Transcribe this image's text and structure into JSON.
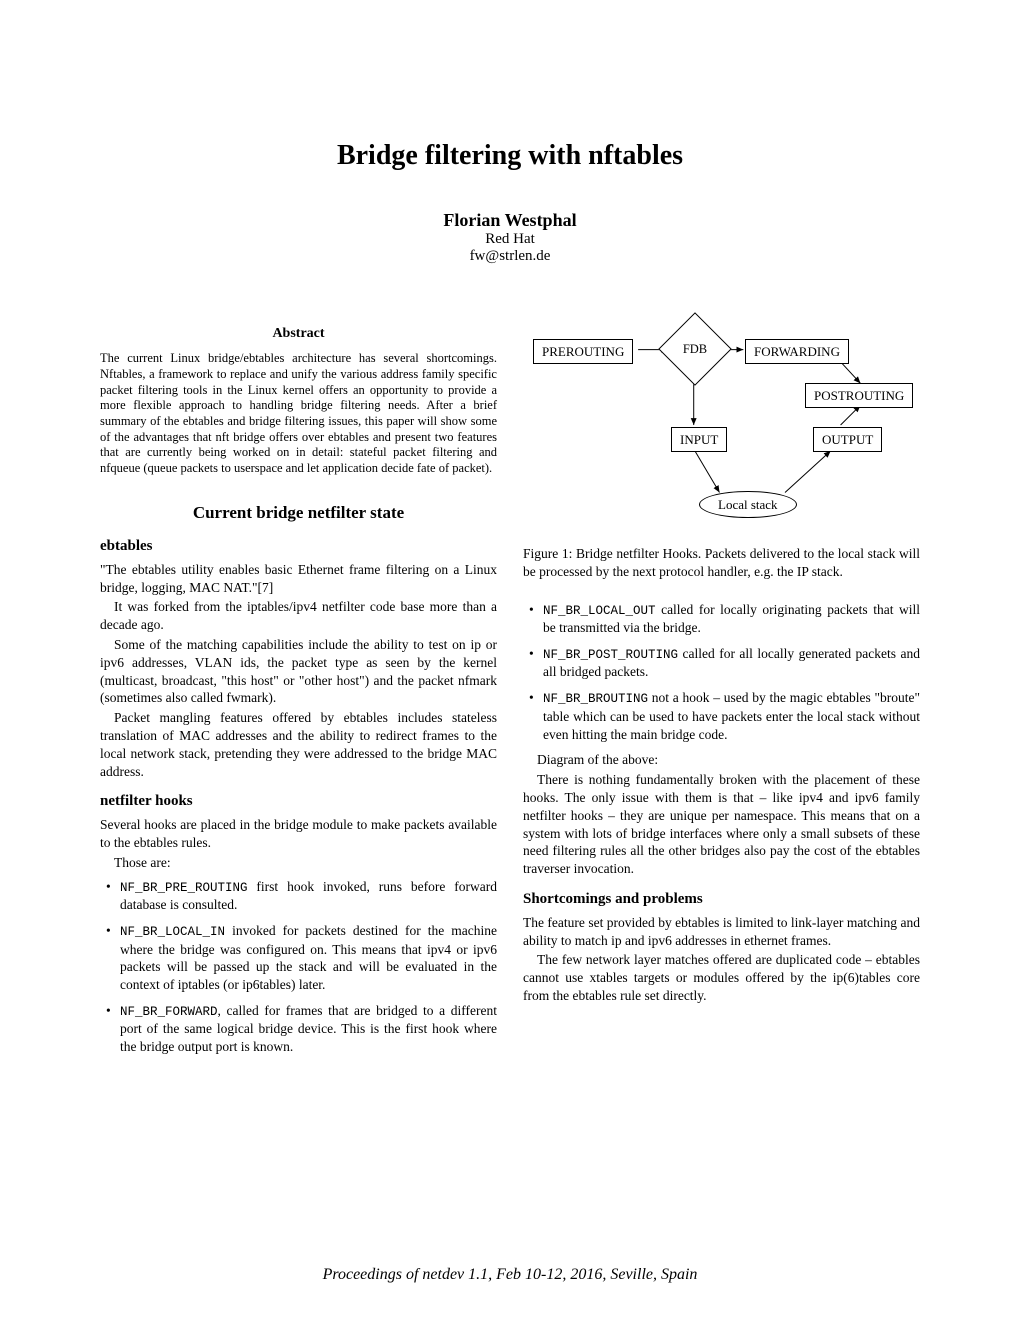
{
  "title": "Bridge filtering with nftables",
  "author": {
    "name": "Florian Westphal",
    "affiliation": "Red Hat",
    "email": "fw@strlen.de"
  },
  "abstract": {
    "heading": "Abstract",
    "text": "The current Linux bridge/ebtables architecture has several shortcomings. Nftables, a framework to replace and unify the various address family specific packet filtering tools in the Linux kernel offers an opportunity to provide a more flexible approach to handling bridge filtering needs. After a brief summary of the ebtables and bridge filtering issues, this paper will show some of the advantages that nft bridge offers over ebtables and present two features that are currently being worked on in detail: stateful packet filtering and nfqueue (queue packets to userspace and let application decide fate of packet)."
  },
  "section1": {
    "title": "Current bridge netfilter state",
    "ebtables": {
      "heading": "ebtables",
      "p1": "\"The ebtables utility enables basic Ethernet frame filtering on a Linux bridge, logging, MAC NAT.\"[7]",
      "p2": "It was forked from the iptables/ipv4 netfilter code base more than a decade ago.",
      "p3": "Some of the matching capabilities include the ability to test on ip or ipv6 addresses, VLAN ids, the packet type as seen by the kernel (multicast, broadcast, \"this host\" or \"other host\") and the packet nfmark (sometimes also called fwmark).",
      "p4": "Packet mangling features offered by ebtables includes stateless translation of MAC addresses and the ability to redirect frames to the local network stack, pretending they were addressed to the bridge MAC address."
    },
    "nfhooks": {
      "heading": "netfilter hooks",
      "intro": "Several hooks are placed in the bridge module to make packets available to the ebtables rules.",
      "those": "Those are:",
      "items_left": [
        {
          "code": "NF_BR_PRE_ROUTING",
          "text": " first hook invoked, runs before forward database is consulted."
        },
        {
          "code": "NF_BR_LOCAL_IN",
          "text": " invoked for packets destined for the machine where the bridge was configured on. This means that ipv4 or ipv6 packets will be passed up the stack and will be evaluated in the context of iptables (or ip6tables) later."
        },
        {
          "code": "NF_BR_FORWARD",
          "text": ", called for frames that are bridged to a different port of the same logical bridge device. This is the first hook where the bridge output port is known."
        }
      ],
      "items_right": [
        {
          "code": "NF_BR_LOCAL_OUT",
          "text": " called for locally originating packets that will be transmitted via the bridge."
        },
        {
          "code": "NF_BR_POST_ROUTING",
          "text": " called for all locally generated packets and all bridged packets."
        },
        {
          "code": "NF_BR_BROUTING",
          "text": " not a hook – used by the magic ebtables \"broute\" table which can be used to have packets enter the local stack without even hitting the main bridge code."
        }
      ],
      "diagram_line": "Diagram of the above:",
      "closing": "There is nothing fundamentally broken with the placement of these hooks. The only issue with them is that – like ipv4 and ipv6 family netfilter hooks – they are unique per namespace. This means that on a system with lots of bridge interfaces where only a small subsets of these need filtering rules all the other bridges also pay the cost of the ebtables traverser invocation."
    },
    "shortcomings": {
      "heading": "Shortcomings and problems",
      "p1": "The feature set provided by ebtables is limited to link-layer matching and ability to match ip and ipv6 addresses in ethernet frames.",
      "p2": "The few network layer matches offered are duplicated code – ebtables cannot use xtables targets or modules offered by the ip(6)tables core from the ebtables rule set directly."
    }
  },
  "figure": {
    "nodes": {
      "prerouting": "PREROUTING",
      "fdb": "FDB",
      "forwarding": "FORWARDING",
      "postrouting": "POSTROUTING",
      "input": "INPUT",
      "output": "OUTPUT",
      "local": "Local stack"
    },
    "caption": "Figure 1: Bridge netfilter Hooks. Packets delivered to the local stack will be processed by the next protocol handler, e.g. the IP stack."
  },
  "footer": "Proceedings of netdev 1.1, Feb 10-12, 2016, Seville, Spain"
}
